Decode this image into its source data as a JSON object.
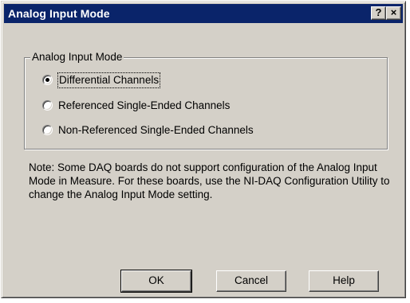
{
  "window": {
    "title": "Analog Input Mode",
    "help_button_label": "?",
    "close_button_label": "×"
  },
  "group": {
    "legend": "Analog Input Mode",
    "options": [
      {
        "label": "Differential Channels",
        "selected": true
      },
      {
        "label": "Referenced Single-Ended Channels",
        "selected": false
      },
      {
        "label": "Non-Referenced Single-Ended Channels",
        "selected": false
      }
    ]
  },
  "note": "Note: Some DAQ boards do not support configuration of the Analog Input Mode in Measure. For these boards, use the NI-DAQ Configuration Utility to change the Analog Input Mode setting.",
  "buttons": {
    "ok": "OK",
    "cancel": "Cancel",
    "help": "Help"
  },
  "colors": {
    "titlebar": "#0a246a",
    "face": "#d4d0c8"
  }
}
